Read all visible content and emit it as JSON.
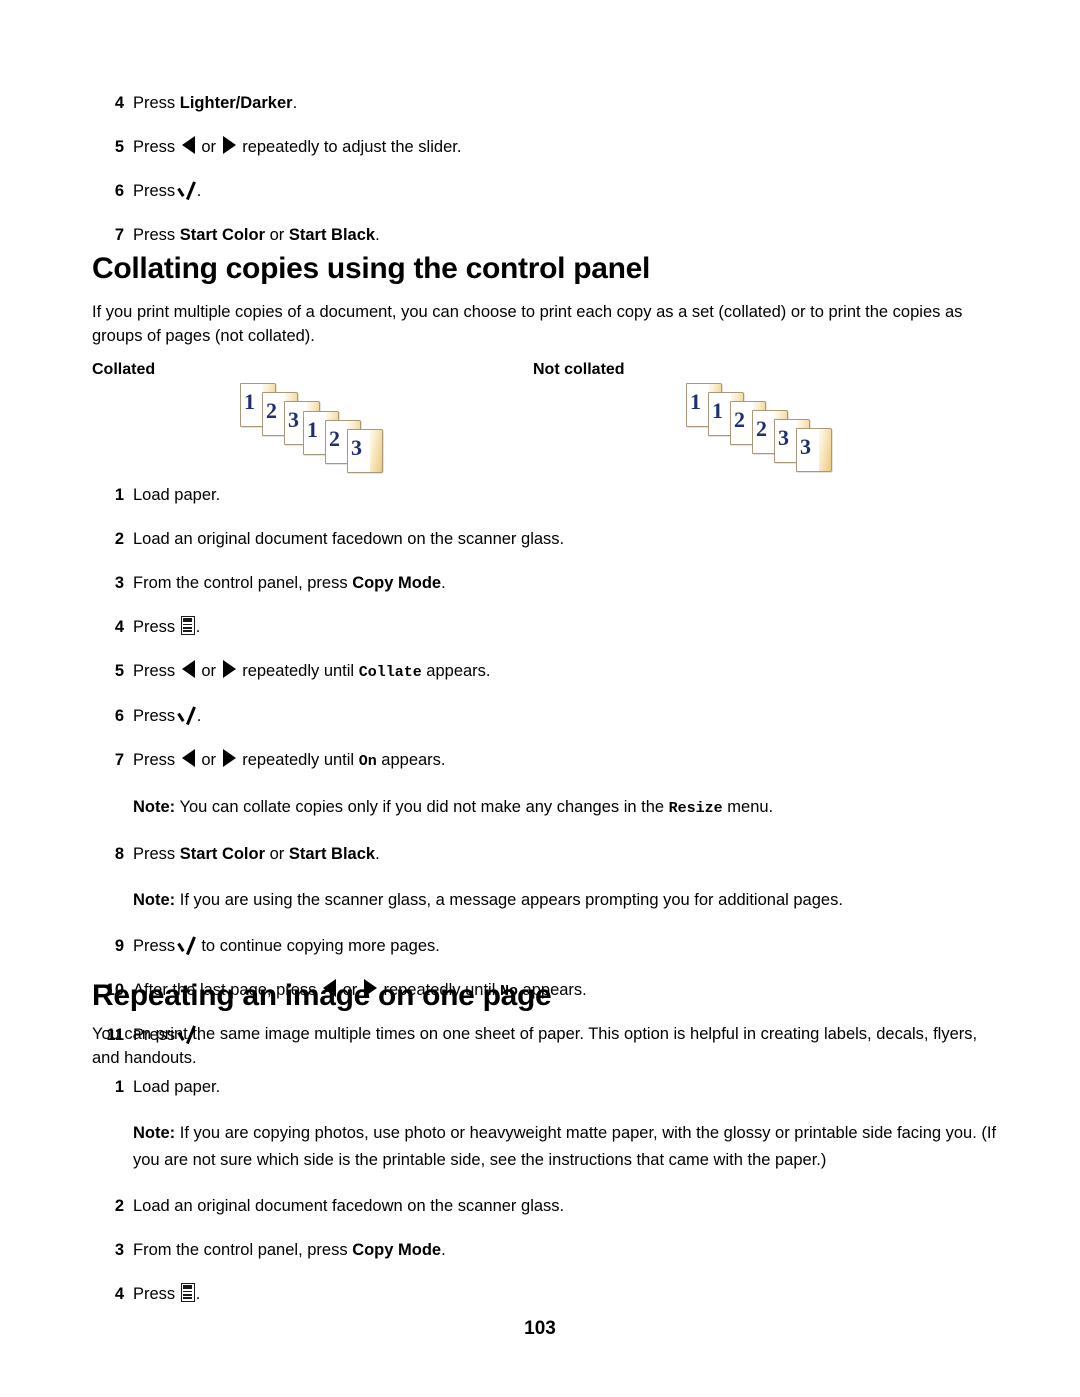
{
  "page": {
    "folio": "103"
  },
  "top_steps": [
    {
      "num": "4",
      "parts": [
        {
          "t": "text",
          "v": "Press "
        },
        {
          "t": "bold",
          "v": "Lighter/Darker"
        },
        {
          "t": "text",
          "v": "."
        }
      ]
    },
    {
      "num": "5",
      "parts": [
        {
          "t": "text",
          "v": "Press "
        },
        {
          "t": "icon",
          "v": "arrow-left-icon"
        },
        {
          "t": "text",
          "v": " or "
        },
        {
          "t": "icon",
          "v": "arrow-right-icon"
        },
        {
          "t": "text",
          "v": " repeatedly to adjust the slider."
        }
      ]
    },
    {
      "num": "6",
      "parts": [
        {
          "t": "text",
          "v": "Press "
        },
        {
          "t": "icon",
          "v": "check-icon"
        },
        {
          "t": "text",
          "v": "."
        }
      ]
    },
    {
      "num": "7",
      "parts": [
        {
          "t": "text",
          "v": "Press "
        },
        {
          "t": "bold",
          "v": "Start Color"
        },
        {
          "t": "text",
          "v": " or "
        },
        {
          "t": "bold",
          "v": "Start Black"
        },
        {
          "t": "text",
          "v": "."
        }
      ]
    }
  ],
  "section_collating": {
    "heading": "Collating copies using the control panel",
    "intro": "If you print multiple copies of a document, you can choose to print each copy as a set (collated) or to print the copies as groups of pages (not collated).",
    "figure": {
      "collated_label": "Collated",
      "not_collated_label": "Not collated",
      "collated_sequence": [
        "1",
        "2",
        "3",
        "1",
        "2",
        "3"
      ],
      "not_collated_sequence": [
        "1",
        "1",
        "2",
        "2",
        "3",
        "3"
      ]
    },
    "steps": [
      {
        "num": "1",
        "parts": [
          {
            "t": "text",
            "v": "Load paper."
          }
        ]
      },
      {
        "num": "2",
        "parts": [
          {
            "t": "text",
            "v": "Load an original document facedown on the scanner glass."
          }
        ]
      },
      {
        "num": "3",
        "parts": [
          {
            "t": "text",
            "v": "From the control panel, press "
          },
          {
            "t": "bold",
            "v": "Copy Mode"
          },
          {
            "t": "text",
            "v": "."
          }
        ]
      },
      {
        "num": "4",
        "parts": [
          {
            "t": "text",
            "v": "Press "
          },
          {
            "t": "icon",
            "v": "menu-icon"
          },
          {
            "t": "text",
            "v": "."
          }
        ]
      },
      {
        "num": "5",
        "parts": [
          {
            "t": "text",
            "v": "Press "
          },
          {
            "t": "icon",
            "v": "arrow-left-icon"
          },
          {
            "t": "text",
            "v": " or "
          },
          {
            "t": "icon",
            "v": "arrow-right-icon"
          },
          {
            "t": "text",
            "v": " repeatedly until "
          },
          {
            "t": "mono",
            "v": "Collate"
          },
          {
            "t": "text",
            "v": " appears."
          }
        ]
      },
      {
        "num": "6",
        "parts": [
          {
            "t": "text",
            "v": "Press "
          },
          {
            "t": "icon",
            "v": "check-icon"
          },
          {
            "t": "text",
            "v": "."
          }
        ]
      },
      {
        "num": "7",
        "parts": [
          {
            "t": "text",
            "v": "Press "
          },
          {
            "t": "icon",
            "v": "arrow-left-icon"
          },
          {
            "t": "text",
            "v": " or "
          },
          {
            "t": "icon",
            "v": "arrow-right-icon"
          },
          {
            "t": "text",
            "v": " repeatedly until "
          },
          {
            "t": "mono",
            "v": "On"
          },
          {
            "t": "text",
            "v": " appears."
          }
        ]
      },
      {
        "num": "",
        "note": true,
        "parts": [
          {
            "t": "bold",
            "v": "Note:"
          },
          {
            "t": "text",
            "v": " You can collate copies only if you did not make any changes in the "
          },
          {
            "t": "mono",
            "v": "Resize"
          },
          {
            "t": "text",
            "v": " menu."
          }
        ]
      },
      {
        "num": "8",
        "parts": [
          {
            "t": "text",
            "v": "Press "
          },
          {
            "t": "bold",
            "v": "Start Color"
          },
          {
            "t": "text",
            "v": " or "
          },
          {
            "t": "bold",
            "v": "Start Black"
          },
          {
            "t": "text",
            "v": "."
          }
        ]
      },
      {
        "num": "",
        "note": true,
        "parts": [
          {
            "t": "bold",
            "v": "Note:"
          },
          {
            "t": "text",
            "v": " If you are using the scanner glass, a message appears prompting you for additional pages."
          }
        ]
      },
      {
        "num": "9",
        "parts": [
          {
            "t": "text",
            "v": "Press "
          },
          {
            "t": "icon",
            "v": "check-icon"
          },
          {
            "t": "text",
            "v": " to continue copying more pages."
          }
        ]
      },
      {
        "num": "10",
        "parts": [
          {
            "t": "text",
            "v": "After the last page, press "
          },
          {
            "t": "icon",
            "v": "arrow-left-icon"
          },
          {
            "t": "text",
            "v": " or "
          },
          {
            "t": "icon",
            "v": "arrow-right-icon"
          },
          {
            "t": "text",
            "v": " repeatedly until "
          },
          {
            "t": "mono",
            "v": "No"
          },
          {
            "t": "text",
            "v": " appears."
          }
        ]
      },
      {
        "num": "11",
        "parts": [
          {
            "t": "text",
            "v": "Press "
          },
          {
            "t": "icon",
            "v": "check-icon"
          },
          {
            "t": "text",
            "v": "."
          }
        ]
      }
    ]
  },
  "section_repeating": {
    "heading": "Repeating an image on one page",
    "intro": "You can print the same image multiple times on one sheet of paper. This option is helpful in creating labels, decals, flyers, and handouts.",
    "steps": [
      {
        "num": "1",
        "parts": [
          {
            "t": "text",
            "v": "Load paper."
          }
        ]
      },
      {
        "num": "",
        "note": true,
        "parts": [
          {
            "t": "bold",
            "v": "Note:"
          },
          {
            "t": "text",
            "v": "  If you are copying photos, use photo or heavyweight matte paper, with the glossy or printable side facing you. (If you are not sure which side is the printable side, see the instructions that came with the paper.)"
          }
        ]
      },
      {
        "num": "2",
        "parts": [
          {
            "t": "text",
            "v": "Load an original document facedown on the scanner glass."
          }
        ]
      },
      {
        "num": "3",
        "parts": [
          {
            "t": "text",
            "v": "From the control panel, press "
          },
          {
            "t": "bold",
            "v": "Copy Mode"
          },
          {
            "t": "text",
            "v": "."
          }
        ]
      },
      {
        "num": "4",
        "parts": [
          {
            "t": "text",
            "v": "Press "
          },
          {
            "t": "icon",
            "v": "menu-icon"
          },
          {
            "t": "text",
            "v": "."
          }
        ]
      }
    ]
  }
}
